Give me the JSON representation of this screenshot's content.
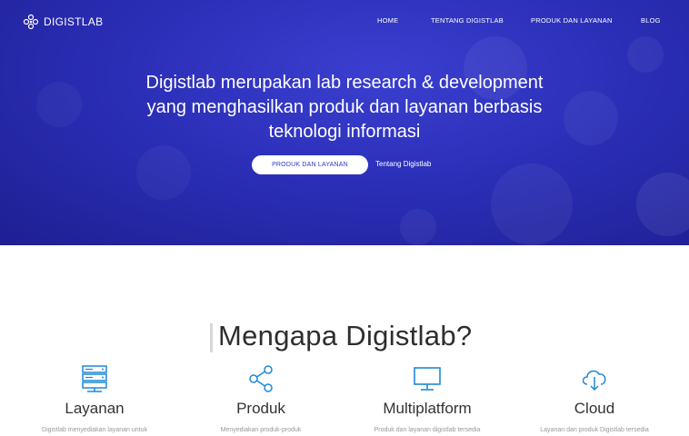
{
  "brand": {
    "name": "DIGISTLAB",
    "logo_icon": "flower-dots-icon"
  },
  "nav": {
    "items": [
      {
        "label": "HOME"
      },
      {
        "label": "TENTANG DIGISTLAB"
      },
      {
        "label": "PRODUK DAN LAYANAN"
      },
      {
        "label": "BLOG"
      }
    ]
  },
  "hero": {
    "headline_line1": "Digistlab merupakan lab research & development",
    "headline_line2": "yang menghasilkan produk dan layanan berbasis",
    "headline_line3": "teknologi informasi",
    "cta_label": "PRODUK DAN LAYANAN",
    "secondary_link": "Tentang Digistlab"
  },
  "why": {
    "title": "Mengapa Digistlab?",
    "features": [
      {
        "icon": "server-stack-icon",
        "title": "Layanan",
        "desc": "Digistlab menyediakan layanan untuk"
      },
      {
        "icon": "share-icon",
        "title": "Produk",
        "desc": "Menyediakan produk-produk"
      },
      {
        "icon": "monitor-icon",
        "title": "Multiplatform",
        "desc": "Produk dan layanan digistlab tersedia"
      },
      {
        "icon": "cloud-download-icon",
        "title": "Cloud",
        "desc": "Layanan dan produk Digistlab tersedia"
      }
    ]
  },
  "colors": {
    "hero_bg": "#2b2fb8",
    "accent": "#1e88d8",
    "cta_text": "#2f39b8"
  }
}
